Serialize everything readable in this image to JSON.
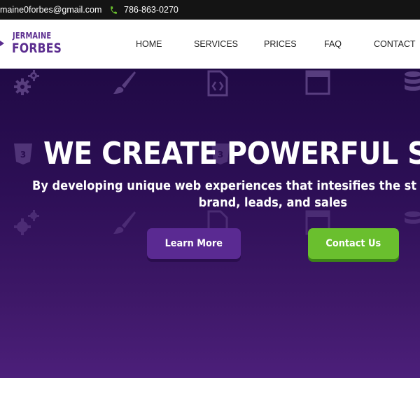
{
  "topbar": {
    "email": "maine0forbes@gmail.com",
    "phone": "786-863-0270"
  },
  "logo": {
    "line1": "JERMAINE",
    "line2": "FORBES"
  },
  "nav": {
    "items": [
      "HOME",
      "SERVICES",
      "PRICES",
      "FAQ",
      "CONTACT"
    ]
  },
  "hero": {
    "title": "WE CREATE POWERFUL S",
    "subtitle_line1": "By developing unique web experiences that intesifies the st",
    "subtitle_line2": "brand, leads, and sales",
    "learn_more_label": "Learn More",
    "contact_us_label": "Contact Us"
  },
  "colors": {
    "brand_purple": "#5b2d8f",
    "accent_green": "#6abf2e",
    "topbar_bg": "#141414",
    "hero_bg_top": "#200a45",
    "hero_bg_bottom": "#4c1f7a"
  },
  "icons": [
    "phone-icon",
    "gears-icon",
    "paintbrush-icon",
    "code-file-icon",
    "browser-window-icon",
    "database-icon",
    "css3-icon"
  ]
}
